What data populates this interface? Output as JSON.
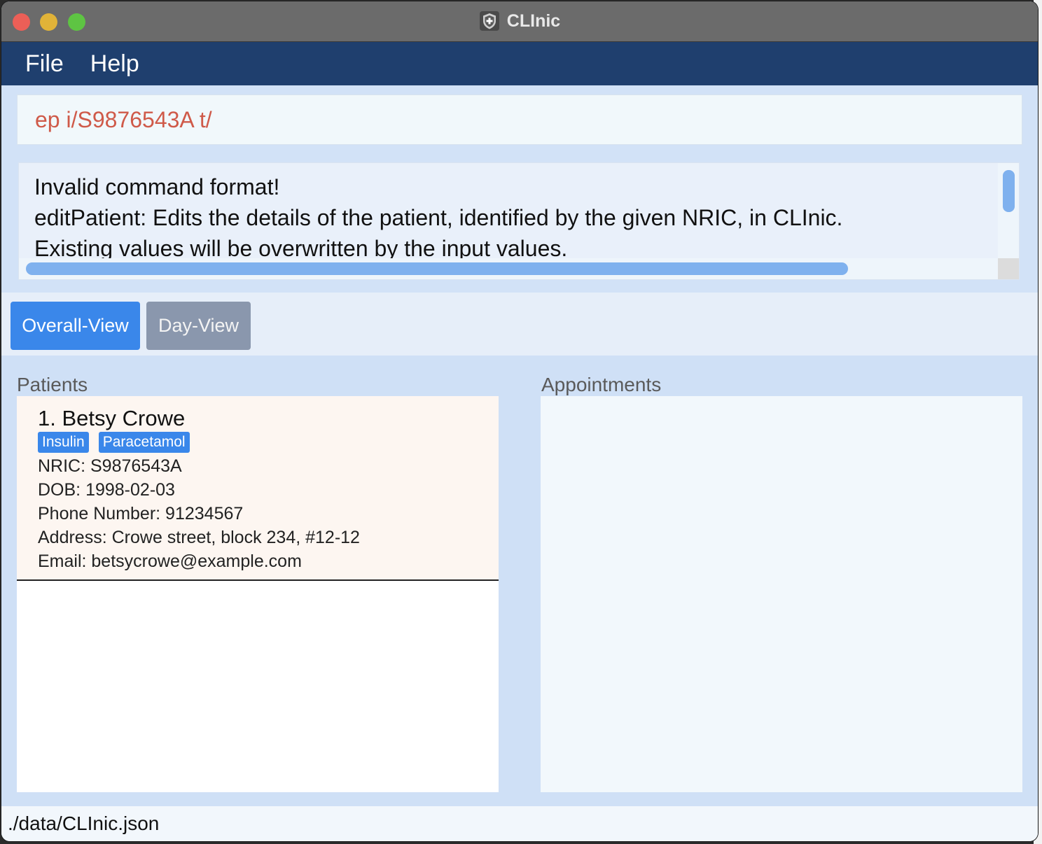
{
  "window": {
    "title": "CLInic"
  },
  "menu": {
    "items": [
      "File",
      "Help"
    ]
  },
  "command": {
    "value": "ep i/S9876543A t/"
  },
  "result": {
    "lines": [
      "Invalid command format!",
      "editPatient: Edits the details of the patient, identified by the given NRIC, in CLInic.",
      "Existing values will be overwritten by the input values."
    ]
  },
  "tabs": [
    {
      "label": "Overall-View",
      "active": true
    },
    {
      "label": "Day-View",
      "active": false
    }
  ],
  "panels": {
    "patients_label": "Patients",
    "appointments_label": "Appointments"
  },
  "patients": [
    {
      "index": "1.",
      "name": "Betsy Crowe",
      "tags": [
        "Insulin",
        "Paracetamol"
      ],
      "nric": "NRIC: S9876543A",
      "dob": "DOB: 1998-02-03",
      "phone": "Phone Number: 91234567",
      "address": "Address: Crowe street, block 234, #12-12",
      "email": "Email: betsycrowe@example.com"
    }
  ],
  "status": {
    "file_path": "./data/CLInic.json"
  },
  "colors": {
    "menubar": "#1f3f6e",
    "accent": "#3a87ea",
    "inactive_tab": "#8a97ad",
    "command_text": "#cf5a49",
    "card_bg": "#fdf6f1"
  },
  "icons": {
    "app": "shield-cross-icon"
  }
}
